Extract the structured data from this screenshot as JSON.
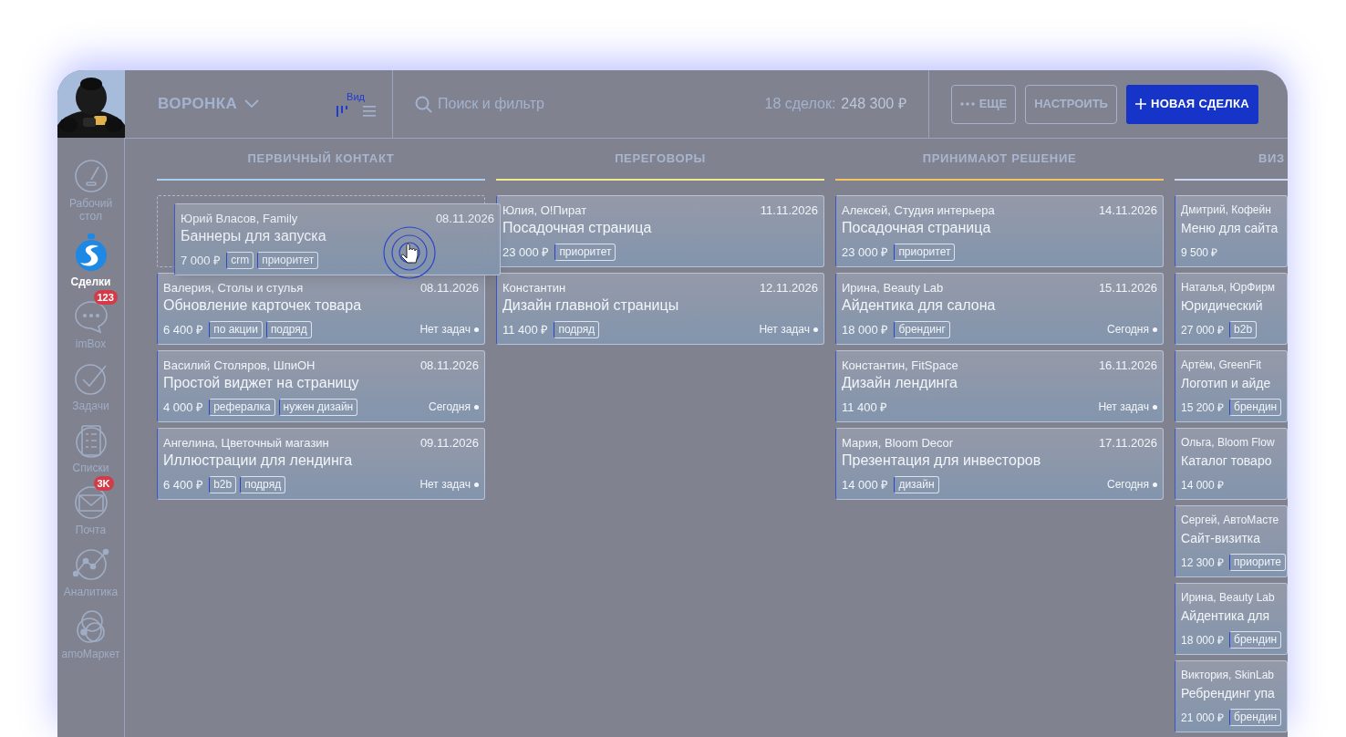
{
  "sidebar": {
    "items": [
      {
        "kind": "dashboard",
        "label": "Рабочий стол",
        "selected": false
      },
      {
        "kind": "deals",
        "label": "Сделки",
        "selected": true
      },
      {
        "kind": "chat",
        "label": "imBox",
        "selected": false,
        "badge": "123"
      },
      {
        "kind": "tasks",
        "label": "Задачи",
        "selected": false
      },
      {
        "kind": "lists",
        "label": "Списки",
        "selected": false
      },
      {
        "kind": "mail",
        "label": "Почта",
        "selected": false,
        "badge": "3K"
      },
      {
        "kind": "analytics",
        "label": "Аналитика",
        "selected": false
      },
      {
        "kind": "market",
        "label": "amoМаркет",
        "selected": false
      }
    ]
  },
  "header": {
    "pipeline": "ВОРОНКА",
    "view_label": "Вид",
    "views": [
      {
        "kind": "kanban",
        "selected": true
      },
      {
        "kind": "list",
        "selected": false
      }
    ],
    "search_placeholder": "Поиск и фильтр",
    "deals_count": "18 сделок:",
    "deals_total": "248 300 ₽",
    "buttons": [
      {
        "kind": "more",
        "label": "ЕЩЕ"
      },
      {
        "kind": "plain",
        "label": "НАСТРОИТЬ"
      },
      {
        "kind": "primary",
        "label": "НОВАЯ СДЕЛКА"
      }
    ]
  },
  "dragged_card": {
    "name": "Юрий Власов, Family",
    "date": "08.11.2026",
    "title": "Баннеры для запуска",
    "price": "7 000 ₽",
    "tags": [
      "crm",
      "приоритет"
    ]
  },
  "columns": [
    {
      "title": "ПЕРВИЧНЫЙ КОНТАКТ",
      "color": "#a9cdf2",
      "drop_placeholder": true,
      "cards": [
        {
          "name": "Валерия, Столы и стулья",
          "date": "08.11.2026",
          "title": "Обновление карточек товара",
          "price": "6 400 ₽",
          "tags": [
            "по акции",
            "подряд"
          ],
          "task": "Нет задач"
        },
        {
          "name": "Василий Столяров, ШпиОН",
          "date": "08.11.2026",
          "title": "Простой виджет на страницу",
          "price": "4 000 ₽",
          "tags": [
            "рефералка",
            "нужен дизайн"
          ],
          "task": "Сегодня"
        },
        {
          "name": "Ангелина, Цветочный магазин",
          "date": "09.11.2026",
          "title": "Иллюстрации для лендинга",
          "price": "6 400 ₽",
          "tags": [
            "b2b",
            "подряд"
          ],
          "task": "Нет задач"
        }
      ]
    },
    {
      "title": "ПЕРЕГОВОРЫ",
      "color": "#f1ea8c",
      "drop_placeholder": false,
      "cards": [
        {
          "name": "Юлия, О!Пират",
          "date": "11.11.2026",
          "title": "Посадочная страница",
          "price": "23 000 ₽",
          "tags": [
            "приоритет"
          ]
        },
        {
          "name": "Константин",
          "date": "12.11.2026",
          "title": "Дизайн главной страницы",
          "price": "11 400 ₽",
          "tags": [
            "подряд"
          ],
          "task": "Нет задач"
        }
      ]
    },
    {
      "title": "ПРИНИМАЮТ РЕШЕНИЕ",
      "color": "#f3c460",
      "drop_placeholder": false,
      "cards": [
        {
          "name": "Алексей, Студия интерьера",
          "date": "14.11.2026",
          "title": "Посадочная страница",
          "price": "23 000 ₽",
          "tags": [
            "приоритет"
          ]
        },
        {
          "name": "Ирина, Beauty Lab",
          "date": "15.11.2026",
          "title": "Айдентика для салона",
          "price": "18 000 ₽",
          "tags": [
            "брендинг"
          ],
          "task": "Сегодня"
        },
        {
          "name": "Константин, FitSpace",
          "date": "16.11.2026",
          "title": "Дизайн лендинга",
          "price": "11 400 ₽",
          "task": "Нет задач"
        },
        {
          "name": "Мария, Bloom Decor",
          "date": "17.11.2026",
          "title": "Презентация для инвесторов",
          "price": "14 000 ₽",
          "tags": [
            "дизайн"
          ],
          "task": "Сегодня"
        }
      ]
    },
    {
      "title": "ВИЗ",
      "color": "#c9d6ee",
      "drop_placeholder": false,
      "cards": [
        {
          "name": "Дмитрий, Кофейн",
          "title": "Меню для сайта",
          "price": "9 500 ₽"
        },
        {
          "name": "Наталья, ЮрФирм",
          "title": "Юридический",
          "price": "27 000 ₽",
          "tags": [
            "b2b"
          ]
        },
        {
          "name": "Артём, GreenFit",
          "title": "Логотип и айде",
          "price": "15 200 ₽",
          "tags": [
            "брендин"
          ]
        },
        {
          "name": "Ольга, Bloom Flow",
          "title": "Каталог товаро",
          "price": "14 000 ₽"
        },
        {
          "name": "Сергей, АвтоМасте",
          "title": "Сайт-визитка",
          "price": "12 300 ₽",
          "tags": [
            "приорите"
          ]
        },
        {
          "name": "Ирина, Beauty Lab",
          "title": "Айдентика для",
          "price": "18 000 ₽",
          "tags": [
            "брендин"
          ]
        },
        {
          "name": "Виктория, SkinLab",
          "title": "Ребрендинг упа",
          "price": "21 000 ₽",
          "tags": [
            "брендин"
          ]
        }
      ]
    }
  ]
}
